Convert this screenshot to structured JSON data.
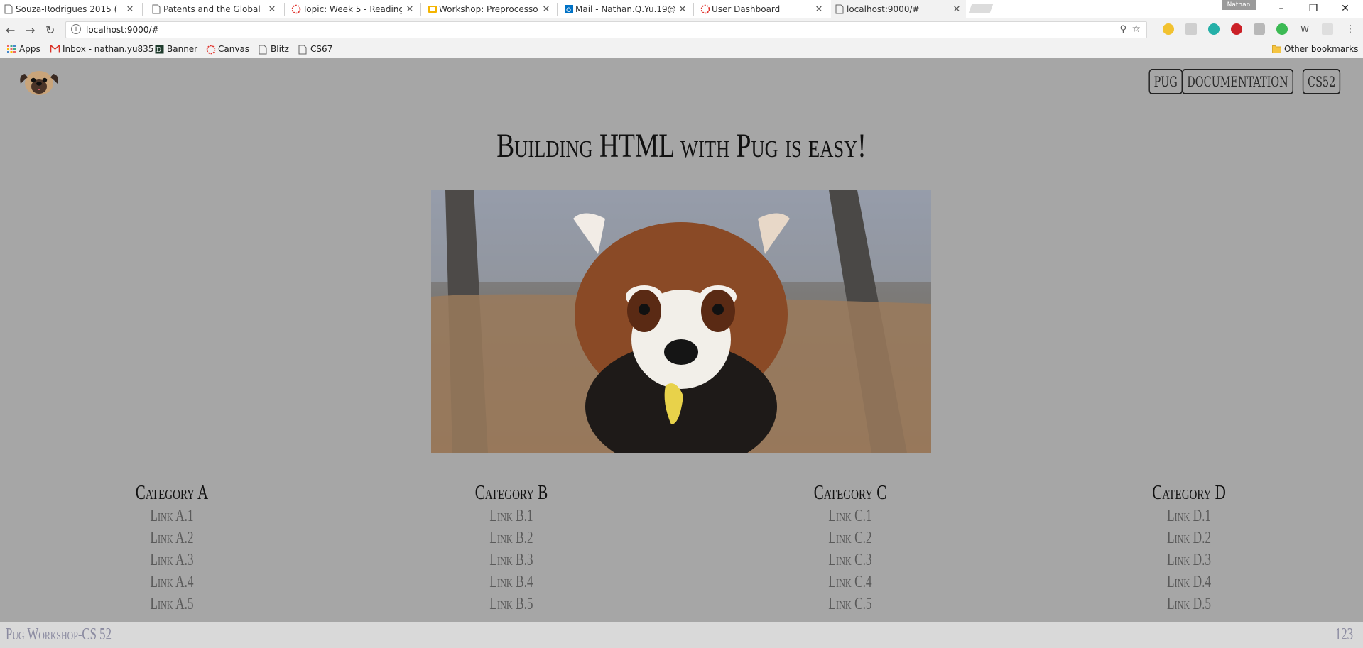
{
  "browser": {
    "tabs": [
      {
        "title": "Souza-Rodrigues 2015 (",
        "favicon": "doc-icon"
      },
      {
        "title": "Patents and the Global D",
        "favicon": "doc-icon"
      },
      {
        "title": "Topic: Week 5 - Reading",
        "favicon": "canvas-icon"
      },
      {
        "title": "Workshop: Preprocessor",
        "favicon": "slides-icon"
      },
      {
        "title": "Mail - Nathan.Q.Yu.19@",
        "favicon": "outlook-icon"
      },
      {
        "title": "User Dashboard",
        "favicon": "canvas-icon"
      },
      {
        "title": "localhost:9000/#",
        "favicon": "doc-icon"
      }
    ],
    "tab_close": "✕",
    "profile_name": "Nathan",
    "url": "localhost:9000/#",
    "bookmarks": [
      {
        "label": "Apps",
        "icon": "apps-grid-icon"
      },
      {
        "label": "Inbox - nathan.yu835",
        "icon": "gmail-icon"
      },
      {
        "label": "Banner",
        "icon": "banner-icon"
      },
      {
        "label": "Canvas",
        "icon": "canvas-icon"
      },
      {
        "label": "Blitz",
        "icon": "doc-icon"
      },
      {
        "label": "CS67",
        "icon": "doc-icon"
      }
    ],
    "other_bookmarks": "Other bookmarks"
  },
  "site": {
    "nav": [
      "PUG",
      "DOCUMENTATION",
      "CS52"
    ],
    "headline": "Building HTML with Pug is easy!",
    "categories": [
      {
        "title": "Category A",
        "links": [
          "Link A.1",
          "Link A.2",
          "Link A.3",
          "Link A.4",
          "Link A.5"
        ]
      },
      {
        "title": "Category B",
        "links": [
          "Link B.1",
          "Link B.2",
          "Link B.3",
          "Link B.4",
          "Link B.5"
        ]
      },
      {
        "title": "Category C",
        "links": [
          "Link C.1",
          "Link C.2",
          "Link C.3",
          "Link C.4",
          "Link C.5"
        ]
      },
      {
        "title": "Category D",
        "links": [
          "Link D.1",
          "Link D.2",
          "Link D.3",
          "Link D.4",
          "Link D.5"
        ]
      }
    ],
    "footer_left": "Pug Workshop-CS 52",
    "footer_right": "123"
  },
  "colors": {
    "page_bg": "#a6a6a6",
    "footer_bg": "#d9d9d9",
    "footer_text": "#8a8aa0"
  }
}
